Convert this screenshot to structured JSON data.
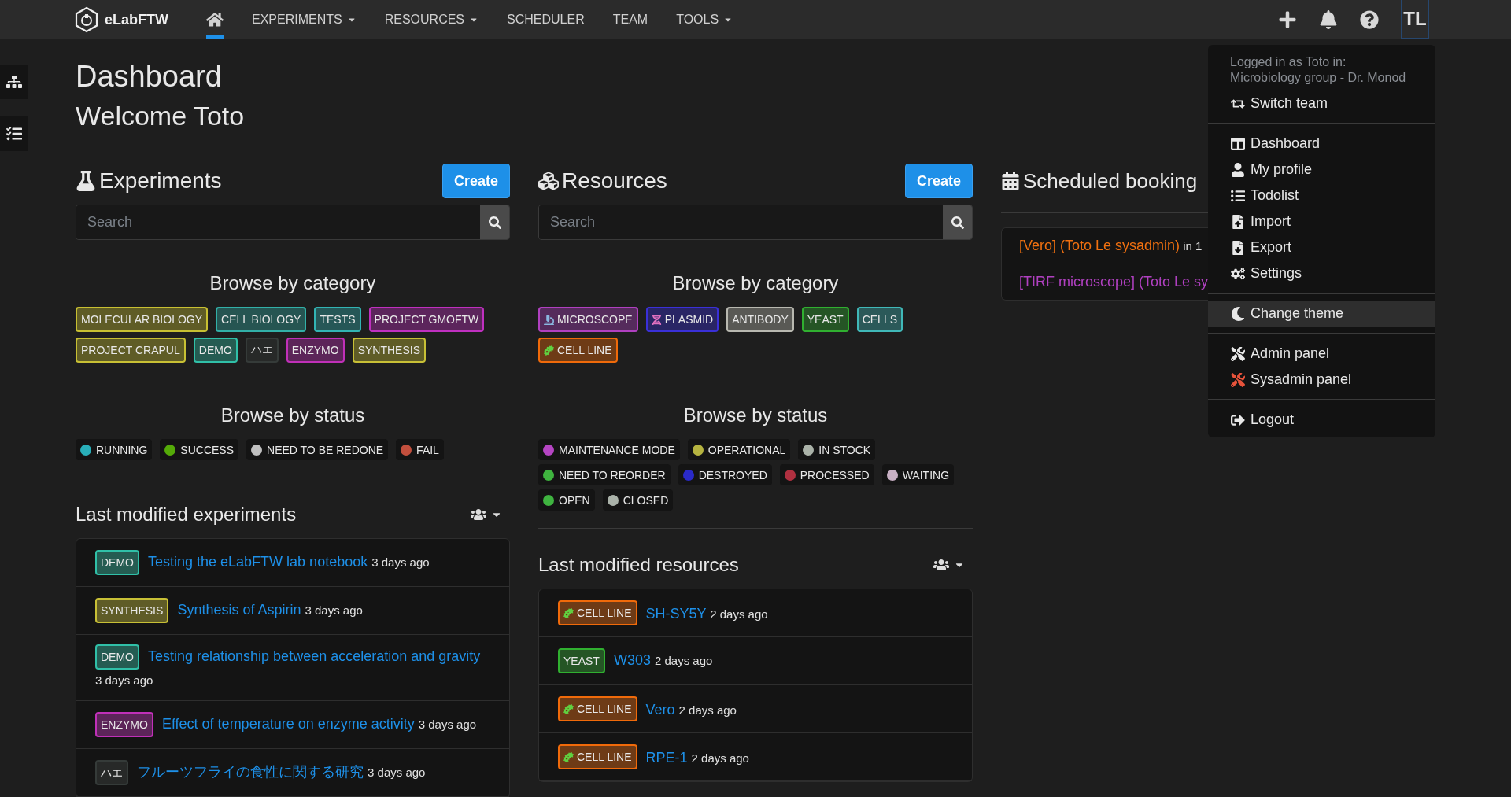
{
  "nav": {
    "brand": "eLabFTW",
    "items": [
      {
        "kind": "home",
        "selected": true
      },
      {
        "kind": "menu",
        "label": "EXPERIMENTS",
        "selected": false
      },
      {
        "kind": "menu",
        "label": "RESOURCES",
        "selected": false
      },
      {
        "kind": "link",
        "label": "SCHEDULER",
        "selected": false
      },
      {
        "kind": "link",
        "label": "TEAM",
        "selected": false
      },
      {
        "kind": "menu",
        "label": "TOOLS",
        "selected": false
      }
    ],
    "avatar": "TL"
  },
  "page": {
    "title": "Dashboard",
    "welcome": "Welcome Toto"
  },
  "experiments": {
    "title": "Experiments",
    "create": "Create",
    "search_placeholder": "Search",
    "category_title": "Browse by category",
    "categories": [
      {
        "label": "MOLECULAR BIOLOGY",
        "color": "#c8c032"
      },
      {
        "label": "CELL BIOLOGY",
        "color": "#32b0a8"
      },
      {
        "label": "TESTS",
        "color": "#32b4b4"
      },
      {
        "label": "PROJECT GMOFTW",
        "color": "#c030c0"
      },
      {
        "label": "PROJECT CRAPUL",
        "color": "#c8c034"
      },
      {
        "label": "DEMO",
        "color": "#30c0a8"
      },
      {
        "label": "ハエ",
        "color": "#353b39"
      },
      {
        "label": "ENZYMO",
        "color": "#c030b8"
      },
      {
        "label": "SYNTHESIS",
        "color": "#c8c036"
      }
    ],
    "status_title": "Browse by status",
    "statuses": [
      {
        "label": "RUNNING",
        "color": "#29aeb9"
      },
      {
        "label": "SUCCESS",
        "color": "#54aa08"
      },
      {
        "label": "NEED TO BE REDONE",
        "color": "#c0c0c0"
      },
      {
        "label": "FAIL",
        "color": "#c24f3d"
      }
    ],
    "last_title": "Last modified experiments",
    "last": [
      {
        "tag": {
          "label": "DEMO",
          "color": "#30c0a8"
        },
        "title": "Testing the eLabFTW lab notebook",
        "time": "3 days ago"
      },
      {
        "tag": {
          "label": "SYNTHESIS",
          "color": "#c8c036"
        },
        "title": "Synthesis of Aspirin",
        "time": "3 days ago"
      },
      {
        "tag": {
          "label": "DEMO",
          "color": "#30c0a8"
        },
        "title": "Testing relationship between acceleration and gravity",
        "time": "3 days ago"
      },
      {
        "tag": {
          "label": "ENZYMO",
          "color": "#c030b8"
        },
        "title": "Effect of temperature on enzyme activity",
        "time": "3 days ago"
      },
      {
        "tag": {
          "label": "ハエ",
          "color": "#353b39"
        },
        "title": "フルーツフライの食性に関する研究",
        "time": "3 days ago"
      }
    ]
  },
  "resources": {
    "title": "Resources",
    "create": "Create",
    "search_placeholder": "Search",
    "category_title": "Browse by category",
    "categories": [
      {
        "label": "MICROSCOPE",
        "color": "#b040c0",
        "kind": "microscope"
      },
      {
        "label": "PLASMID",
        "color": "#3a30d8",
        "kind": "dna"
      },
      {
        "label": "ANTIBODY",
        "color": "#b8b8b0"
      },
      {
        "label": "YEAST",
        "color": "#30b030"
      },
      {
        "label": "CELLS",
        "color": "#40b8b8"
      },
      {
        "label": "CELL LINE",
        "color": "#f06a0a",
        "kind": "microbe"
      }
    ],
    "status_title": "Browse by status",
    "statuses": [
      {
        "label": "MAINTENANCE MODE",
        "color": "#b545c3"
      },
      {
        "label": "OPERATIONAL",
        "color": "#b5b340"
      },
      {
        "label": "IN STOCK",
        "color": "#aab2a8"
      },
      {
        "label": "NEED TO REORDER",
        "color": "#3fb43f"
      },
      {
        "label": "DESTROYED",
        "color": "#2a2ac9"
      },
      {
        "label": "PROCESSED",
        "color": "#b03040"
      },
      {
        "label": "WAITING",
        "color": "#c8b0c4"
      },
      {
        "label": "OPEN",
        "color": "#3fb440"
      },
      {
        "label": "CLOSED",
        "color": "#aab2a9"
      }
    ],
    "last_title": "Last modified resources",
    "last": [
      {
        "tag": {
          "label": "CELL LINE",
          "color": "#f06a0a",
          "kind": "microbe"
        },
        "title": "SH-SY5Y",
        "time": "2 days ago"
      },
      {
        "tag": {
          "label": "YEAST",
          "color": "#30b030"
        },
        "title": "W303",
        "time": "2 days ago"
      },
      {
        "tag": {
          "label": "CELL LINE",
          "color": "#f06a0a",
          "kind": "microbe"
        },
        "title": "Vero",
        "time": "2 days ago"
      },
      {
        "tag": {
          "label": "CELL LINE",
          "color": "#f06a0a",
          "kind": "microbe"
        },
        "title": "RPE-1",
        "time": "2 days ago"
      }
    ]
  },
  "bookings": {
    "title": "Scheduled booking",
    "items": [
      {
        "title": "[Vero] (Toto Le sysadmin)",
        "when": "in 1",
        "color": "#f07010"
      },
      {
        "title": "[TIRF microscope] (Toto Le sy",
        "color": "#b040c0"
      }
    ]
  },
  "user_menu": {
    "info": [
      "Logged in as Toto in:",
      "Microbiology group - Dr. Monod"
    ],
    "groups": [
      [
        {
          "label": "Switch team",
          "highlighted": false
        }
      ],
      [
        {
          "label": "Dashboard",
          "highlighted": false
        },
        {
          "label": "My profile",
          "highlighted": false
        },
        {
          "label": "Todolist",
          "highlighted": false
        },
        {
          "label": "Import",
          "highlighted": false
        },
        {
          "label": "Export",
          "highlighted": false
        },
        {
          "label": "Settings",
          "highlighted": false
        }
      ],
      [
        {
          "label": "Change theme",
          "highlighted": true
        }
      ],
      [
        {
          "label": "Admin panel",
          "highlighted": false
        },
        {
          "label": "Sysadmin panel",
          "highlighted": false
        }
      ],
      [
        {
          "label": "Logout",
          "highlighted": false
        }
      ]
    ]
  }
}
